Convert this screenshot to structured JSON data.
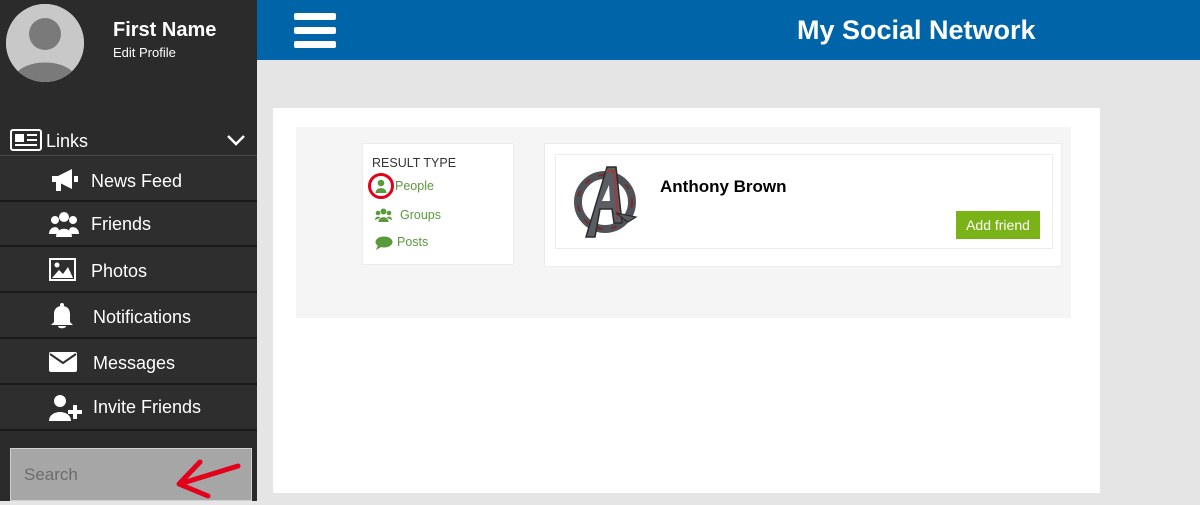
{
  "profile": {
    "name": "First Name",
    "edit_label": "Edit Profile"
  },
  "sidebar": {
    "links_label": "Links",
    "items": [
      {
        "label": "News Feed",
        "icon": "megaphone-icon"
      },
      {
        "label": "Friends",
        "icon": "users-icon"
      },
      {
        "label": "Photos",
        "icon": "image-icon"
      },
      {
        "label": "Notifications",
        "icon": "bell-icon"
      },
      {
        "label": "Messages",
        "icon": "envelope-icon"
      },
      {
        "label": "Invite Friends",
        "icon": "user-plus-icon"
      }
    ]
  },
  "search": {
    "placeholder": "Search"
  },
  "header": {
    "title": "My Social Network"
  },
  "result_type": {
    "title": "RESULT TYPE",
    "options": [
      {
        "label": "People",
        "icon": "user-icon"
      },
      {
        "label": "Groups",
        "icon": "users-icon"
      },
      {
        "label": "Posts",
        "icon": "speech-bubble-icon"
      }
    ]
  },
  "results": [
    {
      "name": "Anthony Brown",
      "action_label": "Add friend",
      "avatar": "avengers-logo"
    }
  ],
  "colors": {
    "header_bg": "#0065a8",
    "sidebar_bg": "#2b2b2b",
    "accent_green": "#7ab317",
    "link_green": "#5b9a3c",
    "highlight_red": "#e2001a"
  }
}
